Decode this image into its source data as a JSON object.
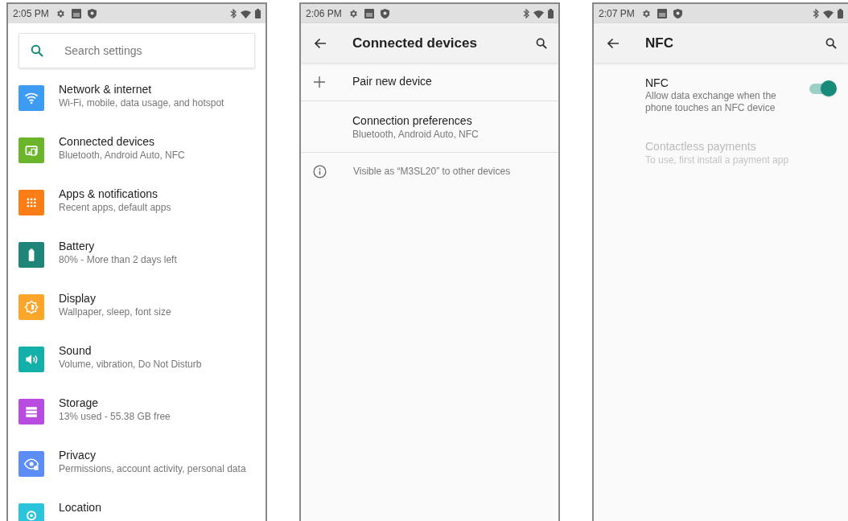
{
  "screens": [
    {
      "kind": "home",
      "status_bar": {
        "time": "2:05 PM"
      },
      "search": {
        "placeholder": "Search settings"
      },
      "items": [
        {
          "title": "Network & internet",
          "subtitle": "Wi-Fi, mobile, data usage, and hotspot",
          "color": "#3d9bf4"
        },
        {
          "title": "Connected devices",
          "subtitle": "Bluetooth, Android Auto, NFC",
          "color": "#6bb52a"
        },
        {
          "title": "Apps & notifications",
          "subtitle": "Recent apps, default apps",
          "color": "#fb7d16"
        },
        {
          "title": "Battery",
          "subtitle": "80% - More than 2 days left",
          "color": "#1f8579"
        },
        {
          "title": "Display",
          "subtitle": "Wallpaper, sleep, font size",
          "color": "#fba62b"
        },
        {
          "title": "Sound",
          "subtitle": "Volume, vibration, Do Not Disturb",
          "color": "#12b0a8"
        },
        {
          "title": "Storage",
          "subtitle": "13% used - 55.38 GB free",
          "color": "#b84be0"
        },
        {
          "title": "Privacy",
          "subtitle": "Permissions, account activity, personal data",
          "color": "#5c8df6"
        },
        {
          "title": "Location",
          "color": "#2cc3dc"
        }
      ]
    },
    {
      "kind": "list",
      "status_bar": {
        "time": "2:06 PM"
      },
      "toolbar": {
        "title": "Connected devices"
      },
      "rows": [
        {
          "kind": "action",
          "title": "Pair new device"
        },
        {
          "kind": "nav",
          "title": "Connection preferences",
          "subtitle": "Bluetooth, Android Auto, NFC"
        },
        {
          "kind": "info",
          "title": "Visible as “M3SL20” to other devices"
        }
      ]
    },
    {
      "kind": "list",
      "status_bar": {
        "time": "2:07 PM"
      },
      "toolbar": {
        "title": "NFC"
      },
      "rows": [
        {
          "kind": "switch",
          "title": "NFC",
          "subtitle": "Allow data exchange when the phone touches an NFC device",
          "on": true,
          "disabled": false
        },
        {
          "kind": "nav",
          "title": "Contactless payments",
          "subtitle": "To use, first install a payment app",
          "disabled": true
        }
      ]
    }
  ]
}
